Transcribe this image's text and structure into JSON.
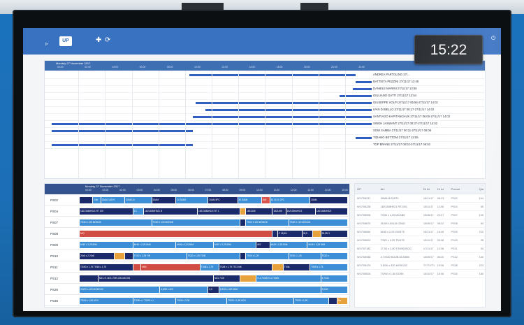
{
  "app": {
    "logo_text": "UP"
  },
  "clock": "15:22",
  "panel1": {
    "date": "Monday 27 November 2017",
    "hours": [
      "00:00",
      "02:00",
      "04:00",
      "06:00",
      "08:00",
      "10:00",
      "12:00",
      "14:00",
      "16:00",
      "18:00",
      "20:00",
      "22:00"
    ],
    "rows": [
      {
        "label": "ANDREA PARTOLINO 27/...",
        "start": 0.43,
        "end": 0.95
      },
      {
        "label": "BATTISTA PEZZINI 27/11/17 13:48",
        "start": 0.95,
        "end": 1.0
      },
      {
        "label": "DANIELE MARINI 27/11/17 13:56",
        "start": 0.94,
        "end": 1.0
      },
      {
        "label": "GIULIANO GATTI 27/11/17 13:54",
        "start": 0.9,
        "end": 1.0
      },
      {
        "label": "GIUSEPPE VOLPI 27/11/17 05:56-27/11/17 14:02",
        "start": 0.45,
        "end": 1.0
      },
      {
        "label": "IVAN DI BELLO 27/11/17 06:17-27/11/17 14:02",
        "start": 0.48,
        "end": 1.0
      },
      {
        "label": "SANTIAGO KAPITANCHUK 27/11/17 06:00-27/11/17 14:02",
        "start": 0.44,
        "end": 1.0
      },
      {
        "label": "SINGH JASWANT 27/11/17 00:37-27/11/17 14:02",
        "start": 0.0,
        "end": 1.0
      },
      {
        "label": "SOW SAMBA 27/11/17 00:11-27/11/17 06:06",
        "start": 0.0,
        "end": 0.44
      },
      {
        "label": "TIZIANO BETTONI 27/11/17 13:55",
        "start": 0.95,
        "end": 1.0
      },
      {
        "label": "TOP BRANE 27/11/17 00:02-27/11/17 06:03",
        "start": 0.0,
        "end": 0.44
      }
    ]
  },
  "panel2": {
    "date": "Monday 27 November 2017",
    "hours": [
      "00:00",
      "01:00",
      "02:00",
      "03:00",
      "04:00",
      "05:00",
      "06:00",
      "07:00",
      "08:00",
      "09:00",
      "10:00",
      "11:00",
      "12:00",
      "13:00",
      "14:00",
      "15:00"
    ],
    "presses": [
      {
        "name": "PS02",
        "segs": [
          {
            "s": 0.0,
            "e": 0.05,
            "c": "#1b2a6b",
            "t": ""
          },
          {
            "s": 0.05,
            "e": 0.08,
            "c": "#3c8fd6",
            "t": "24kt"
          },
          {
            "s": 0.08,
            "e": 0.17,
            "c": "#3c8fd6",
            "t": "30AM-15219"
          },
          {
            "s": 0.17,
            "e": 0.27,
            "c": "#3c8fd6",
            "t": "30AM 2x"
          },
          {
            "s": 0.27,
            "e": 0.36,
            "c": "#1b2a6b",
            "t": "30AM"
          },
          {
            "s": 0.36,
            "e": 0.48,
            "c": "#3c8fd6",
            "t": "20 30AM"
          },
          {
            "s": 0.48,
            "e": 0.59,
            "c": "#1b2a6b",
            "t": "30AM 5PC"
          },
          {
            "s": 0.59,
            "e": 0.68,
            "c": "#3c8fd6",
            "t": "30 30AM"
          },
          {
            "s": 0.68,
            "e": 0.71,
            "c": "#d9544f",
            "t": "AM"
          },
          {
            "s": 0.71,
            "e": 0.86,
            "c": "#3c8fd6",
            "t": "30 30 20 3PC"
          },
          {
            "s": 0.86,
            "e": 1.0,
            "c": "#1b2a6b",
            "t": "30AM"
          }
        ]
      },
      {
        "name": "PS04",
        "segs": [
          {
            "s": 0.0,
            "e": 0.2,
            "c": "#1b2a6b",
            "t": "18213084H021 RT 100"
          },
          {
            "s": 0.2,
            "e": 0.24,
            "c": "#3c8fd6",
            "t": "1C"
          },
          {
            "s": 0.24,
            "e": 0.44,
            "c": "#1b2a6b",
            "t": "18213084H021 B"
          },
          {
            "s": 0.44,
            "e": 0.6,
            "c": "#1b2a6b",
            "t": "18213084H021 RT 1"
          },
          {
            "s": 0.6,
            "e": 0.62,
            "c": "#e8a23c",
            "t": ""
          },
          {
            "s": 0.62,
            "e": 0.72,
            "c": "#1b2a6b",
            "t": "1821306"
          },
          {
            "s": 0.72,
            "e": 0.77,
            "c": "#1b2a6b",
            "t": "1821306"
          },
          {
            "s": 0.77,
            "e": 0.88,
            "c": "#1b2a6b",
            "t": "18213084H021"
          },
          {
            "s": 0.88,
            "e": 1.0,
            "c": "#1b2a6b",
            "t": "18213084H021"
          }
        ]
      },
      {
        "name": "PS07",
        "segs": [
          {
            "s": 0.0,
            "e": 0.27,
            "c": "#3c8fd6",
            "t": "TS30 X 120 MONO8"
          },
          {
            "s": 0.27,
            "e": 0.6,
            "c": "#3c8fd6",
            "t": "TS30 X 120 MONO8"
          },
          {
            "s": 0.6,
            "e": 0.62,
            "c": "#1b2a6b",
            "t": ""
          },
          {
            "s": 0.62,
            "e": 0.78,
            "c": "#3c8fd6",
            "t": "TS30 X 120 MONO8"
          },
          {
            "s": 0.78,
            "e": 1.0,
            "c": "#3c8fd6",
            "t": "TS30 X 120 MONO8"
          }
        ]
      },
      {
        "name": "PS08",
        "segs": [
          {
            "s": 0.0,
            "e": 0.72,
            "c": "#d14d43",
            "t": "M/G"
          },
          {
            "s": 0.72,
            "e": 0.74,
            "c": "#1b2a6b",
            "t": ""
          },
          {
            "s": 0.74,
            "e": 0.83,
            "c": "#1b2a6b",
            "t": "F 35,5N"
          },
          {
            "s": 0.83,
            "e": 0.87,
            "c": "#1b2a6b",
            "t": "35,5"
          },
          {
            "s": 0.87,
            "e": 0.9,
            "c": "#e8a23c",
            "t": ""
          },
          {
            "s": 0.9,
            "e": 1.0,
            "c": "#1b2a6b",
            "t": "35,5N 3"
          }
        ]
      },
      {
        "name": "PS09",
        "segs": [
          {
            "s": 0.0,
            "e": 0.2,
            "c": "#3c8fd6",
            "t": "M/45 x 2,25 M/M"
          },
          {
            "s": 0.2,
            "e": 0.36,
            "c": "#3c8fd6",
            "t": "M/45 x 2,25 M/M"
          },
          {
            "s": 0.36,
            "e": 0.5,
            "c": "#3c8fd6",
            "t": "M/45 x 2,25 M/M"
          },
          {
            "s": 0.5,
            "e": 0.66,
            "c": "#3c8fd6",
            "t": "M/45 x 2,25 M/M"
          },
          {
            "s": 0.66,
            "e": 0.71,
            "c": "#1b2a6b",
            "t": "M/2"
          },
          {
            "s": 0.71,
            "e": 0.85,
            "c": "#3c8fd6",
            "t": "M/45 x 2,25 M/M"
          },
          {
            "s": 0.85,
            "e": 1.0,
            "c": "#3c8fd6",
            "t": "M/45 x 2,25 M/M"
          }
        ]
      },
      {
        "name": "PS10",
        "segs": [
          {
            "s": 0.0,
            "e": 0.13,
            "c": "#1b2a6b",
            "t": "20x8 x 2 20x8"
          },
          {
            "s": 0.13,
            "e": 0.17,
            "c": "#e8a23c",
            "t": ""
          },
          {
            "s": 0.17,
            "e": 0.2,
            "c": "#1b2a6b",
            "t": ""
          },
          {
            "s": 0.2,
            "e": 0.4,
            "c": "#3c8fd6",
            "t": "TS20 x 1,25 Y/B"
          },
          {
            "s": 0.4,
            "e": 0.6,
            "c": "#3c8fd6",
            "t": "TS20 x 1,25 TS/M"
          },
          {
            "s": 0.6,
            "e": 0.62,
            "c": "#1b2a6b",
            "t": ""
          },
          {
            "s": 0.62,
            "e": 0.78,
            "c": "#3c8fd6",
            "t": "TS20 x 1,25"
          },
          {
            "s": 0.78,
            "e": 0.9,
            "c": "#3c8fd6",
            "t": "TS20 x 1,25"
          },
          {
            "s": 0.9,
            "e": 1.0,
            "c": "#3c8fd6",
            "t": "TS20 x"
          }
        ]
      },
      {
        "name": "PS11",
        "segs": [
          {
            "s": 0.0,
            "e": 0.2,
            "c": "#1b2a6b",
            "t": "TS/60 x 1,75 TS/60 x 1,75"
          },
          {
            "s": 0.2,
            "e": 0.23,
            "c": "#d14d43",
            "t": ""
          },
          {
            "s": 0.23,
            "e": 0.45,
            "c": "#d14d43",
            "t": "M60"
          },
          {
            "s": 0.45,
            "e": 0.52,
            "c": "#3c8fd6",
            "t": "TS48 x 1,75"
          },
          {
            "s": 0.52,
            "e": 0.72,
            "c": "#1b2a6b",
            "t": "TS48 x 1,75 TS74 M6"
          },
          {
            "s": 0.72,
            "e": 0.76,
            "c": "#e8a23c",
            "t": ""
          },
          {
            "s": 0.76,
            "e": 0.86,
            "c": "#1b2a6b",
            "t": "TS48"
          },
          {
            "s": 0.86,
            "e": 1.0,
            "c": "#3c8fd6",
            "t": "TS48 x 1,75"
          }
        ]
      },
      {
        "name": "PS12",
        "segs": [
          {
            "s": 0.0,
            "e": 0.07,
            "c": "#1b2a6b",
            "t": ""
          },
          {
            "s": 0.07,
            "e": 0.5,
            "c": "#1b2a6b",
            "t": "M21-71 M21-7099-200-M6 DIN"
          },
          {
            "s": 0.5,
            "e": 0.6,
            "c": "#1b2a6b",
            "t": "M21 7100"
          },
          {
            "s": 0.6,
            "e": 0.66,
            "c": "#e8a23c",
            "t": ""
          },
          {
            "s": 0.66,
            "e": 0.9,
            "c": "#3c8fd6",
            "t": "E 4,7X400 E 4,7X400"
          },
          {
            "s": 0.9,
            "e": 1.0,
            "c": "#3c8fd6",
            "t": "4,7X40"
          }
        ]
      },
      {
        "name": "PS26",
        "segs": [
          {
            "s": 0.0,
            "e": 0.3,
            "c": "#3c8fd6",
            "t": "3,5/30 x 420 MO8/CO2"
          },
          {
            "s": 0.3,
            "e": 0.48,
            "c": "#3c8fd6",
            "t": "3,5/30 x 420"
          },
          {
            "s": 0.48,
            "e": 0.52,
            "c": "#1b2a6b",
            "t": "3,5"
          },
          {
            "s": 0.52,
            "e": 0.9,
            "c": "#3c8fd6",
            "t": "3,5/30 x 420 MO8"
          },
          {
            "s": 0.9,
            "e": 1.0,
            "c": "#3c8fd6",
            "t": "3,5/30"
          }
        ]
      },
      {
        "name": "PS30",
        "segs": [
          {
            "s": 0.0,
            "e": 0.2,
            "c": "#3c8fd6",
            "t": "TS/90 x 1,50 ACN"
          },
          {
            "s": 0.2,
            "e": 0.36,
            "c": "#3c8fd6",
            "t": "TS/90 x 1 TS/90 x 1"
          },
          {
            "s": 0.36,
            "e": 0.55,
            "c": "#3c8fd6",
            "t": "TS/90 x 2,00"
          },
          {
            "s": 0.55,
            "e": 0.8,
            "c": "#3c8fd6",
            "t": "TS/90 x 1,50 ACN"
          },
          {
            "s": 0.8,
            "e": 0.93,
            "c": "#3c8fd6",
            "t": "TS/90 x 1,50"
          },
          {
            "s": 0.93,
            "e": 0.96,
            "c": "#1b2a6b",
            "t": ""
          },
          {
            "s": 0.96,
            "e": 1.0,
            "c": "#e8a23c",
            "t": "Ste"
          }
        ]
      }
    ]
  },
  "panel3": {
    "columns": [
      "OP",
      "Art.",
      "Dt Ini",
      "Hr Ini",
      "Pressa",
      "Qta"
    ],
    "rows": [
      [
        "W17/06237",
        "30MA11/22AT0",
        "15/11/17",
        "08:23",
        "PS02",
        "164"
      ],
      [
        "W17/06228",
        "1821308H021 RT1001",
        "15/11/17",
        "12:56",
        "PS04",
        "65"
      ],
      [
        "W17/05528",
        "TS30 x 1,20 MCAB8",
        "15/06/17",
        "22:37",
        "PS07",
        "120"
      ],
      [
        "W17/05670",
        "35,5X4,5X115 CB4D",
        "15/05/17",
        "08:32",
        "PS08",
        "84"
      ],
      [
        "W17/06064",
        "M/45 x 2,25 X0257S",
        "15/11/17",
        "15:46",
        "PS09",
        "220"
      ],
      [
        "W17/05922",
        "TS20 x 1,25 TS/4TE",
        "13/11/17",
        "03:38",
        "PS10",
        "28"
      ],
      [
        "W17/07182",
        "17,00 x 2,00 TS/MKDSOC",
        "17/11/17",
        "12:36",
        "PS11",
        "54"
      ],
      [
        "W17/05948",
        "4,7X400 EDUB DCSB00",
        "15/09/17",
        "06:20",
        "PS12",
        "140"
      ],
      [
        "W17/05479",
        "3,5/30 x 420 MO5CO2",
        "TY/TV/T1",
        "19:36",
        "PS26",
        "224"
      ],
      [
        "W17/05526",
        "TS/90 x 1,50 DDSK",
        "15/10/17",
        "15:06",
        "PS30",
        "180"
      ]
    ]
  }
}
